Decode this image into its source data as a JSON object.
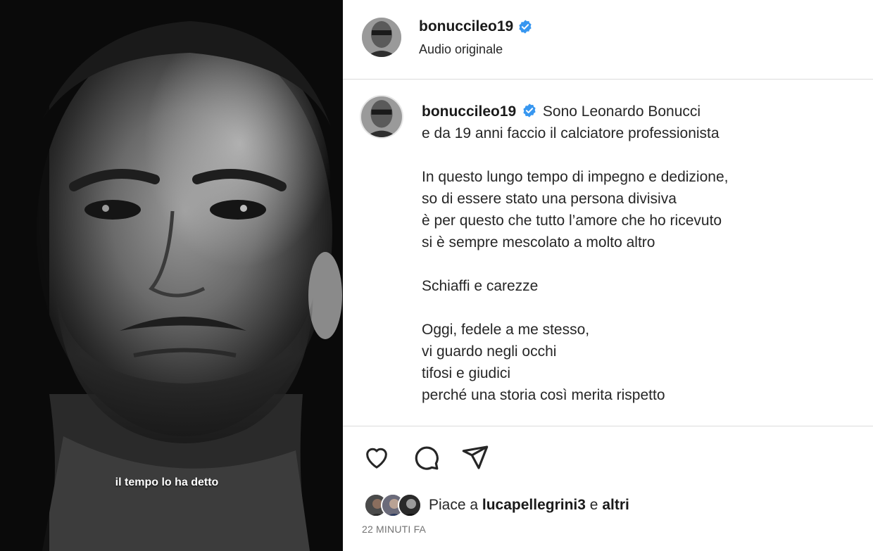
{
  "media": {
    "subtitle": "il tempo lo ha detto"
  },
  "header": {
    "username": "bonuccileo19",
    "audio": "Audio originale"
  },
  "caption": {
    "username": "bonuccileo19",
    "lines": [
      "Sono Leonardo Bonucci",
      "e da 19 anni faccio il calciatore professionista",
      "",
      "In questo lungo tempo di impegno e dedizione,",
      "so di essere stato una persona divisiva",
      "è per questo che tutto l’amore che ho ricevuto",
      "si è sempre mescolato a molto altro",
      "",
      "Schiaffi e carezze",
      "",
      "Oggi, fedele a me stesso,",
      "vi guardo negli occhi",
      "tifosi e giudici",
      "perché una storia così merita rispetto"
    ]
  },
  "actions": {
    "icons": [
      "heart-icon",
      "comment-icon",
      "share-icon"
    ]
  },
  "likes": {
    "prefix": "Piace a",
    "user": "lucapellegrini3",
    "joiner": "e",
    "others": "altri"
  },
  "timestamp": "22 MINUTI FA",
  "colors": {
    "verified": "#3897f0",
    "border": "#dbdbdb",
    "muted": "#737373"
  }
}
